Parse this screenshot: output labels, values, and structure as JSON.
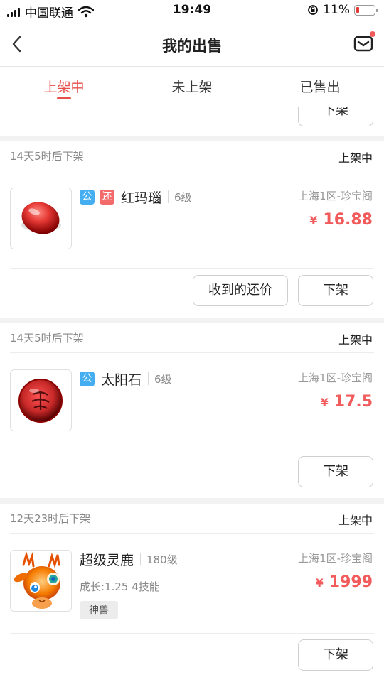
{
  "status_bar": {
    "carrier": "中国联通",
    "time": "19:49",
    "battery": "11%"
  },
  "header": {
    "title": "我的出售"
  },
  "tabs": [
    {
      "label": "上架中",
      "active": true
    },
    {
      "label": "未上架",
      "active": false
    },
    {
      "label": "已售出",
      "active": false
    }
  ],
  "top_partial": {
    "delist_label": "下架"
  },
  "listings": [
    {
      "timer": "14天5时后下架",
      "status": "上架中",
      "badges": [
        "公",
        "还"
      ],
      "name": "红玛瑙",
      "level": "6级",
      "server": "上海1区-珍宝阁",
      "currency": "¥",
      "price": "16.88",
      "buttons": [
        "收到的还价",
        "下架"
      ]
    },
    {
      "timer": "14天5时后下架",
      "status": "上架中",
      "badges": [
        "公"
      ],
      "name": "太阳石",
      "level": "6级",
      "server": "上海1区-珍宝阁",
      "currency": "¥",
      "price": "17.5",
      "buttons": [
        "下架"
      ]
    },
    {
      "timer": "12天23时后下架",
      "status": "上架中",
      "badges": [],
      "name": "超级灵鹿",
      "level": "180级",
      "extra": "成长:1.25 4技能",
      "tag": "神兽",
      "server": "上海1区-珍宝阁",
      "currency": "¥",
      "price": "1999",
      "buttons": [
        "下架"
      ]
    }
  ],
  "colors": {
    "accent": "#e6504a",
    "price": "#f25b5b",
    "badge_public": "#45aef1",
    "badge_counter": "#f26a6a"
  }
}
